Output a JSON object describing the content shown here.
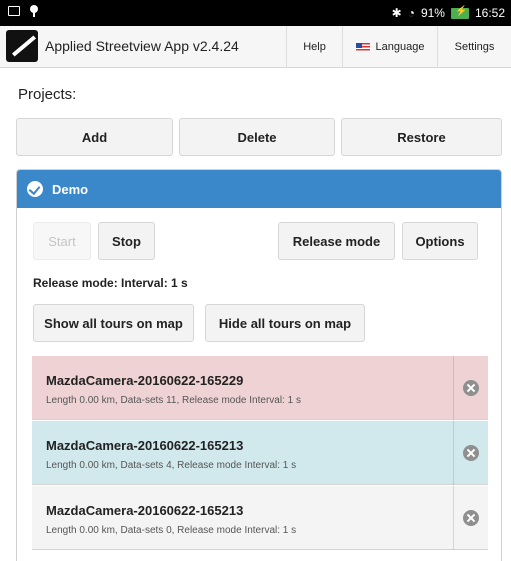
{
  "statusbar": {
    "battery": "91%",
    "time": "16:52"
  },
  "actionbar": {
    "title": "Applied Streetview App v2.4.24",
    "help": "Help",
    "language": "Language",
    "settings": "Settings"
  },
  "projects_label": "Projects:",
  "project_buttons": {
    "add": "Add",
    "delete": "Delete",
    "restore": "Restore"
  },
  "project": {
    "name": "Demo",
    "start": "Start",
    "stop": "Stop",
    "release_mode": "Release mode",
    "options": "Options",
    "status": "Release mode: Interval: 1 s",
    "show_all": "Show all tours on map",
    "hide_all": "Hide all tours on map"
  },
  "tours": [
    {
      "title": "MazdaCamera-20160622-165229",
      "subtitle": "Length 0.00 km, Data-sets 11, Release mode Interval: 1 s",
      "color": "#efd3d4"
    },
    {
      "title": "MazdaCamera-20160622-165213",
      "subtitle": "Length 0.00 km, Data-sets 4, Release mode Interval: 1 s",
      "color": "#d1e9ed"
    },
    {
      "title": "MazdaCamera-20160622-165213",
      "subtitle": "Length 0.00 km, Data-sets 0, Release mode Interval: 1 s",
      "color": "#f4f4f4"
    }
  ],
  "colors": {
    "accent": "#3a87c9"
  }
}
